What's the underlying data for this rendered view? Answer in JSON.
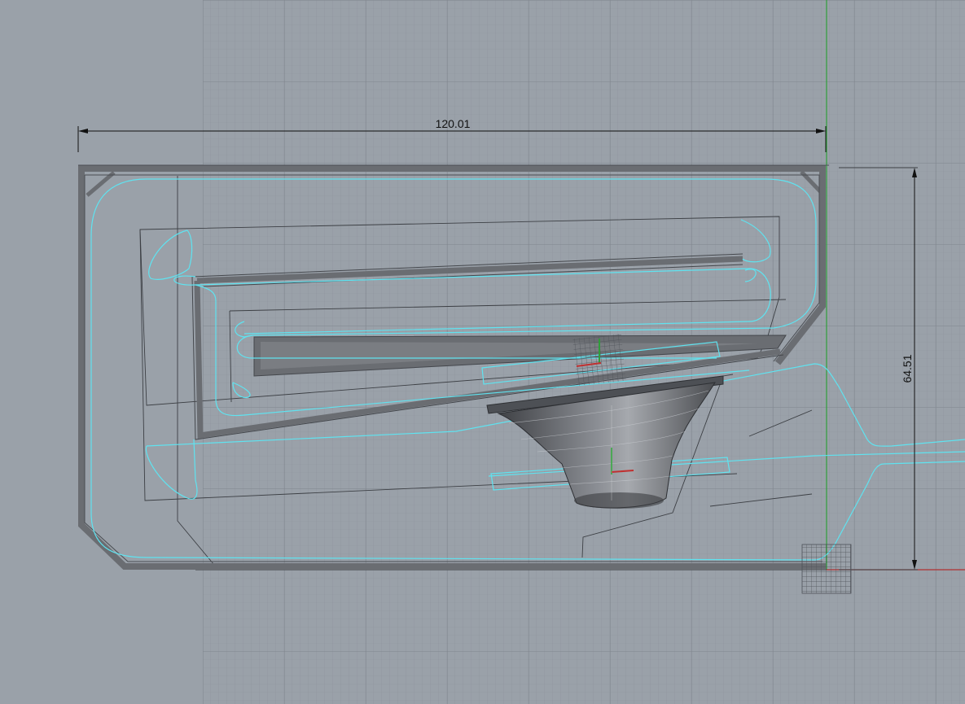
{
  "viewport": {
    "view": "top",
    "background_color": "#9aa1a9",
    "grid_visible": true,
    "grid_color": "#8b9199",
    "grid_major_color": "#7d838b",
    "x_axis_color": "#b03030",
    "y_axis_color": "#2f9e3a"
  },
  "dimensions": {
    "width_value": "120.01",
    "height_value": "64.51"
  },
  "model": {
    "enclosure_color": "#6f7278",
    "curve_color": "#5fe3f0",
    "driver_color": "#5b5e63"
  },
  "icons": {
    "gumball_upper": "gumball-widget-icon",
    "gumball_lower": "gumball-widget-icon",
    "origin_marker": "origin-grid-icon"
  }
}
